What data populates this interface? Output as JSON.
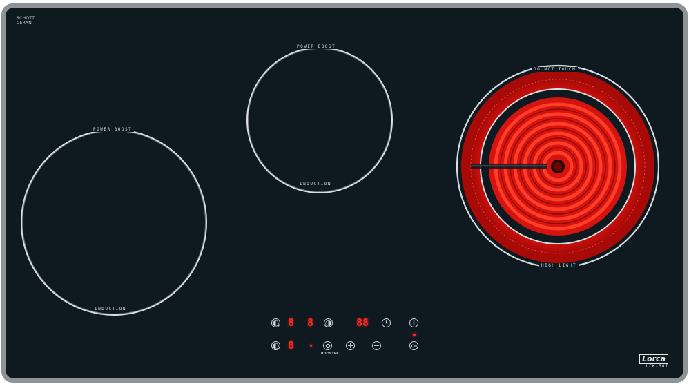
{
  "hob": {
    "brand_line1": "SCHOTT",
    "brand_line2": "CERAN",
    "left_zone": {
      "top_label": "POWER BOOST",
      "bottom_label": "INDUCTION"
    },
    "middle_zone": {
      "top_label": "POWER BOOST",
      "bottom_label": "INDUCTION"
    },
    "right_zone": {
      "top_label": "DO NOT TOUCH",
      "bottom_label": "HIGH LIGHT"
    },
    "display": {
      "zone1": "8",
      "zone2": "8",
      "timer": "88",
      "zone3": "8"
    },
    "booster_label": "BOOSTER",
    "logo_name": "Lorca",
    "logo_model": "LCK-307",
    "colors": {
      "glass": "#0f1a20",
      "led": "#ff2a1e",
      "heater": "#e8140f"
    }
  }
}
